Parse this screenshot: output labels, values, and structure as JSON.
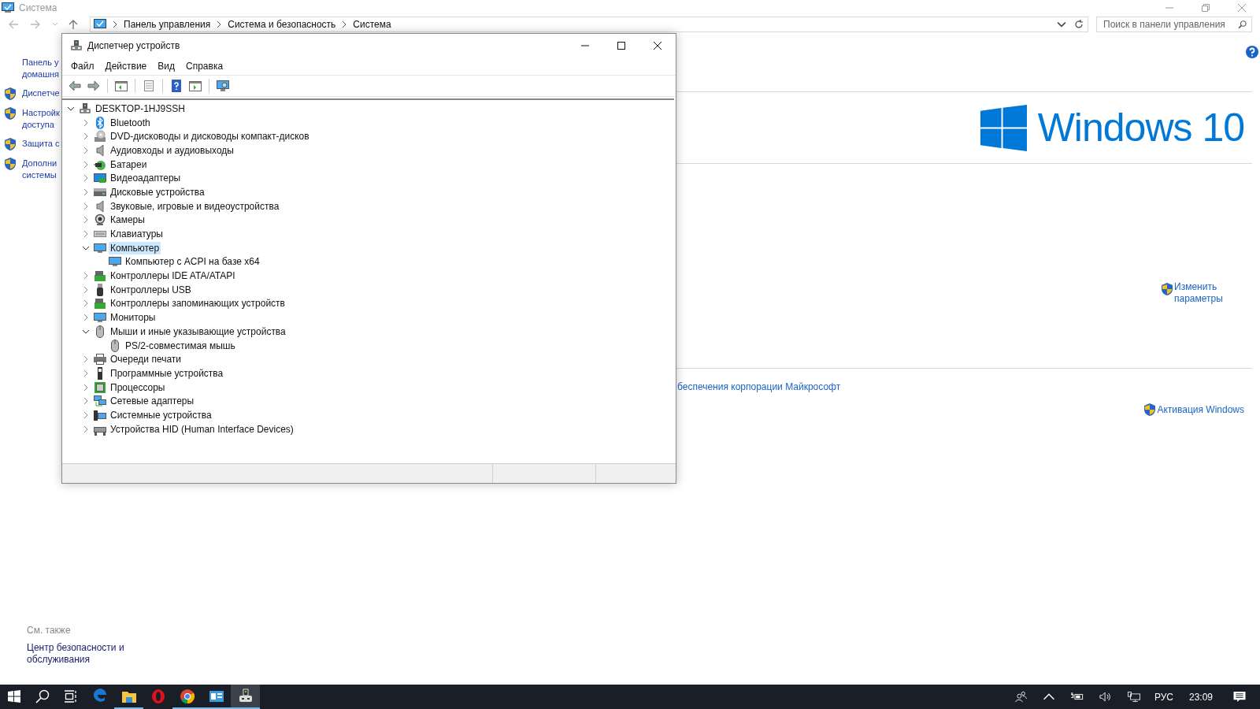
{
  "system_window": {
    "title": "Система",
    "breadcrumb": [
      "Панель управления",
      "Система и безопасность",
      "Система"
    ],
    "search": {
      "placeholder": "Поиск в панели управления"
    },
    "sidebar": {
      "items": [
        {
          "lines": [
            "Панель у",
            "домашня"
          ],
          "shield": false
        },
        {
          "lines": [
            "Диспетче"
          ],
          "shield": true
        },
        {
          "lines": [
            "Настройк",
            "доступа"
          ],
          "shield": true
        },
        {
          "lines": [
            "Защита с"
          ],
          "shield": true
        },
        {
          "lines": [
            "Дополни",
            "системы"
          ],
          "shield": true
        }
      ]
    },
    "see_also": {
      "heading": "См. также",
      "links": [
        "Центр безопасности и обслуживания"
      ]
    },
    "logo_text": "Windows 10",
    "change_settings": "Изменить параметры",
    "ms_link": "беспечения корпорации Майкрософт",
    "activation": "Активация Windows"
  },
  "device_manager": {
    "title": "Диспетчер устройств",
    "menu": [
      "Файл",
      "Действие",
      "Вид",
      "Справка"
    ],
    "toolbar": [
      {
        "kind": "back"
      },
      {
        "kind": "forward"
      },
      {
        "kind": "sep"
      },
      {
        "kind": "tree"
      },
      {
        "kind": "sep"
      },
      {
        "kind": "properties"
      },
      {
        "kind": "sep"
      },
      {
        "kind": "help"
      },
      {
        "kind": "run"
      },
      {
        "kind": "sep"
      },
      {
        "kind": "scan"
      }
    ],
    "tree": {
      "label": "DESKTOP-1HJ9SSH",
      "kind": "root",
      "expanded": true,
      "selected": false,
      "children": [
        {
          "label": "Bluetooth",
          "kind": "bluetooth",
          "expanded": false,
          "selected": false
        },
        {
          "label": "DVD-дисководы и дисководы компакт-дисков",
          "kind": "dvd",
          "expanded": false,
          "selected": false
        },
        {
          "label": "Аудиовходы и аудиовыходы",
          "kind": "speaker",
          "expanded": false,
          "selected": false
        },
        {
          "label": "Батареи",
          "kind": "battery",
          "expanded": false,
          "selected": false
        },
        {
          "label": "Видеоадаптеры",
          "kind": "display",
          "expanded": false,
          "selected": false
        },
        {
          "label": "Дисковые устройства",
          "kind": "disk",
          "expanded": false,
          "selected": false
        },
        {
          "label": "Звуковые, игровые и видеоустройства",
          "kind": "speaker",
          "expanded": false,
          "selected": false
        },
        {
          "label": "Камеры",
          "kind": "camera",
          "expanded": false,
          "selected": false
        },
        {
          "label": "Клавиатуры",
          "kind": "keyboard",
          "expanded": false,
          "selected": false
        },
        {
          "label": "Компьютер",
          "kind": "computer",
          "expanded": true,
          "selected": true,
          "children": [
            {
              "label": "Компьютер с ACPI на базе x64",
              "kind": "computer",
              "selected": false
            }
          ]
        },
        {
          "label": "Контроллеры IDE ATA/ATAPI",
          "kind": "board",
          "expanded": false,
          "selected": false
        },
        {
          "label": "Контроллеры USB",
          "kind": "usb",
          "expanded": false,
          "selected": false
        },
        {
          "label": "Контроллеры запоминающих устройств",
          "kind": "board",
          "expanded": false,
          "selected": false
        },
        {
          "label": "Мониторы",
          "kind": "computer",
          "expanded": false,
          "selected": false
        },
        {
          "label": "Мыши и иные указывающие устройства",
          "kind": "mouse",
          "expanded": true,
          "selected": false,
          "children": [
            {
              "label": "PS/2-совместимая мышь",
              "kind": "mouse",
              "selected": false
            }
          ]
        },
        {
          "label": "Очереди печати",
          "kind": "printer",
          "expanded": false,
          "selected": false
        },
        {
          "label": "Программные устройства",
          "kind": "software",
          "expanded": false,
          "selected": false
        },
        {
          "label": "Процессоры",
          "kind": "cpu",
          "expanded": false,
          "selected": false
        },
        {
          "label": "Сетевые адаптеры",
          "kind": "network",
          "expanded": false,
          "selected": false
        },
        {
          "label": "Системные устройства",
          "kind": "system",
          "expanded": false,
          "selected": false
        },
        {
          "label": "Устройства HID (Human Interface Devices)",
          "kind": "hid",
          "expanded": false,
          "selected": false
        }
      ]
    }
  },
  "taskbar": {
    "apps": [
      {
        "kind": "edge",
        "running": false,
        "selected": false
      },
      {
        "kind": "explorer",
        "running": true,
        "selected": false
      },
      {
        "kind": "opera",
        "running": false,
        "selected": false
      },
      {
        "kind": "chrome",
        "running": true,
        "selected": false
      },
      {
        "kind": "control-panel",
        "running": true,
        "selected": false
      },
      {
        "kind": "device-manager",
        "running": true,
        "selected": true
      }
    ],
    "language": "РУС",
    "clock": "23:09"
  }
}
